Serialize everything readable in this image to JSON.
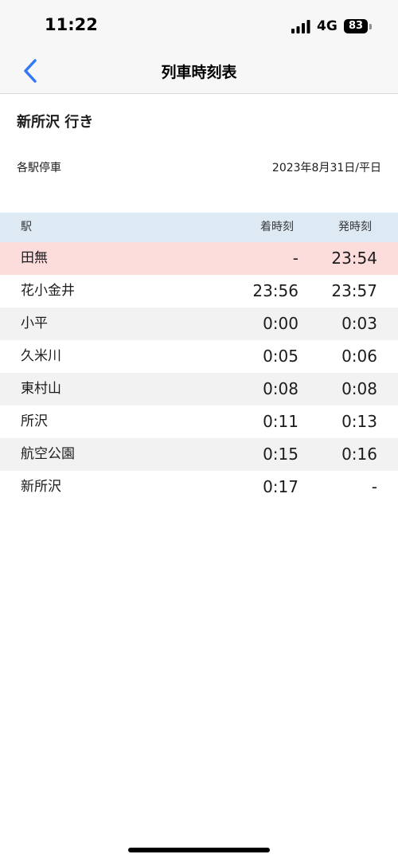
{
  "status_bar": {
    "time": "11:22",
    "network": "4G",
    "battery": "83"
  },
  "nav": {
    "title": "列車時刻表",
    "back_icon": "chevron-left-icon"
  },
  "train": {
    "destination": "新所沢 行き",
    "type": "各駅停車",
    "date": "2023年8月31日/平日"
  },
  "table": {
    "headers": {
      "station": "駅",
      "arrival": "着時刻",
      "departure": "発時刻"
    },
    "rows": [
      {
        "station": "田無",
        "arrival": "-",
        "departure": "23:54",
        "highlight": true
      },
      {
        "station": "花小金井",
        "arrival": "23:56",
        "departure": "23:57"
      },
      {
        "station": "小平",
        "arrival": "0:00",
        "departure": "0:03"
      },
      {
        "station": "久米川",
        "arrival": "0:05",
        "departure": "0:06"
      },
      {
        "station": "東村山",
        "arrival": "0:08",
        "departure": "0:08"
      },
      {
        "station": "所沢",
        "arrival": "0:11",
        "departure": "0:13"
      },
      {
        "station": "航空公園",
        "arrival": "0:15",
        "departure": "0:16"
      },
      {
        "station": "新所沢",
        "arrival": "0:17",
        "departure": "-"
      }
    ]
  },
  "colors": {
    "accent": "#3478f6",
    "header_bg": "#dde9f3",
    "highlight_bg": "#fddcdc",
    "alt_row_bg": "#f2f2f2"
  }
}
